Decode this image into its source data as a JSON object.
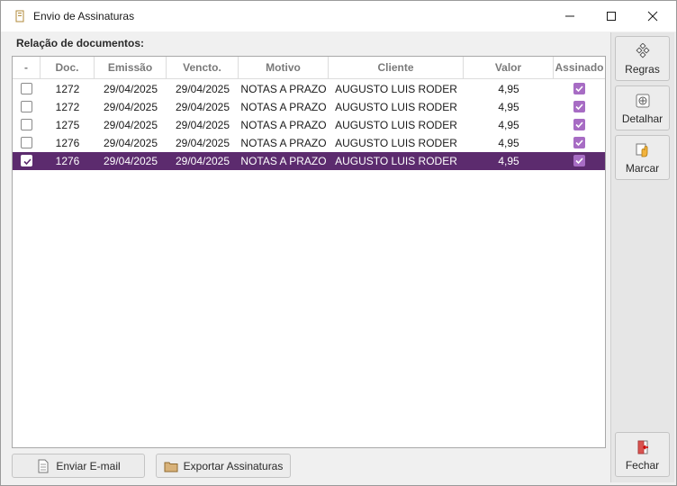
{
  "window": {
    "title": "Envio de Assinaturas"
  },
  "section_label": "Relação de documentos:",
  "columns": [
    "-",
    "Doc.",
    "Emissão",
    "Vencto.",
    "Motivo",
    "Cliente",
    "Valor",
    "Assinado"
  ],
  "rows": [
    {
      "checked": false,
      "doc": "1272",
      "emissao": "29/04/2025",
      "vencto": "29/04/2025",
      "motivo": "NOTAS A PRAZO",
      "cliente": "AUGUSTO LUIS RODER",
      "valor": "4,95",
      "assinado": true,
      "selected": false
    },
    {
      "checked": false,
      "doc": "1272",
      "emissao": "29/04/2025",
      "vencto": "29/04/2025",
      "motivo": "NOTAS A PRAZO",
      "cliente": "AUGUSTO LUIS RODER",
      "valor": "4,95",
      "assinado": true,
      "selected": false
    },
    {
      "checked": false,
      "doc": "1275",
      "emissao": "29/04/2025",
      "vencto": "29/04/2025",
      "motivo": "NOTAS A PRAZO",
      "cliente": "AUGUSTO LUIS RODER",
      "valor": "4,95",
      "assinado": true,
      "selected": false
    },
    {
      "checked": false,
      "doc": "1276",
      "emissao": "29/04/2025",
      "vencto": "29/04/2025",
      "motivo": "NOTAS A PRAZO",
      "cliente": "AUGUSTO LUIS RODER",
      "valor": "4,95",
      "assinado": true,
      "selected": false
    },
    {
      "checked": true,
      "doc": "1276",
      "emissao": "29/04/2025",
      "vencto": "29/04/2025",
      "motivo": "NOTAS A PRAZO",
      "cliente": "AUGUSTO LUIS RODER",
      "valor": "4,95",
      "assinado": true,
      "selected": true
    }
  ],
  "sidebar": {
    "regras": "Regras",
    "detalhar": "Detalhar",
    "marcar": "Marcar",
    "fechar": "Fechar"
  },
  "bottom": {
    "enviar_email": "Enviar E-mail",
    "exportar": "Exportar Assinaturas"
  },
  "colors": {
    "selection": "#5c2b6e",
    "check_accent": "#a76cc4"
  }
}
